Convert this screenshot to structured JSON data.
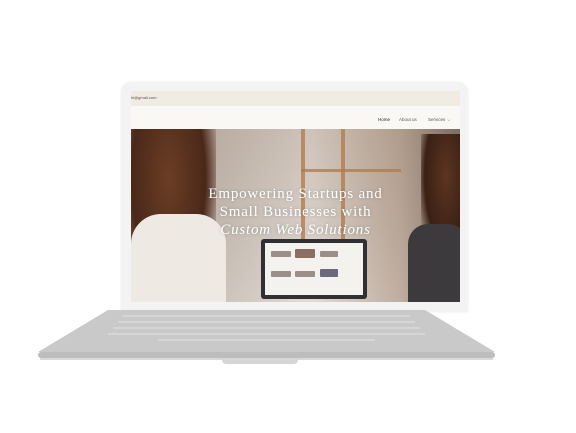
{
  "topbar": {
    "email": "hi@gmail.com"
  },
  "nav": {
    "items": [
      {
        "label": "Home",
        "active": true
      },
      {
        "label": "About us",
        "active": false
      },
      {
        "label": "Services",
        "active": false,
        "has_dropdown": true
      }
    ],
    "dropdown_icon": "chevron-down-icon"
  },
  "hero": {
    "title_line1": "Empowering Startups and",
    "title_line2": "Small Businesses with",
    "title_line3": "Custom Web Solutions"
  },
  "colors": {
    "screen_bg": "#faf8f5",
    "topbar_bg": "#f0ebe3",
    "hero_text": "#ffffff",
    "laptop_body": "#c9c9c9"
  }
}
